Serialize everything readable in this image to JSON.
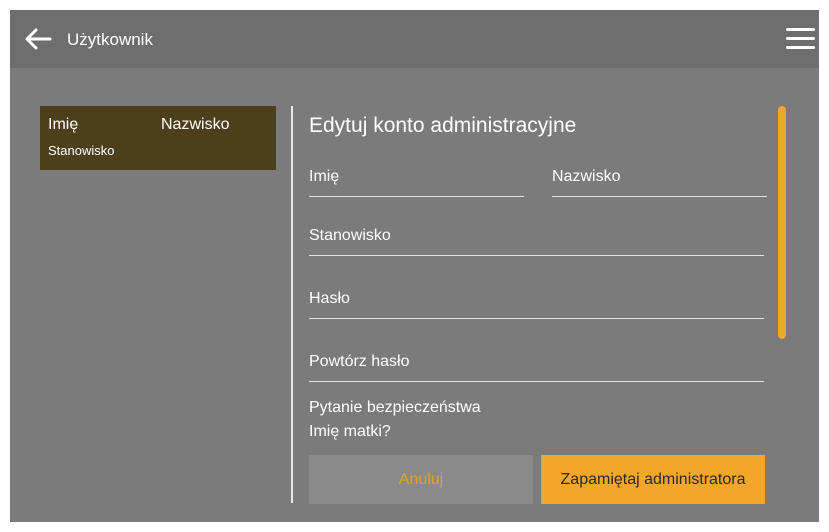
{
  "header": {
    "title": "Użytkownik",
    "back_icon": "arrow-left-icon",
    "menu_icon": "hamburger-menu-icon"
  },
  "user_card": {
    "first_name": "Imię",
    "last_name": "Nazwisko",
    "position": "Stanowisko"
  },
  "form": {
    "title": "Edytuj konto administracyjne",
    "first_name_placeholder": "Imię",
    "last_name_placeholder": "Nazwisko",
    "position_placeholder": "Stanowisko",
    "password_placeholder": "Hasło",
    "repeat_password_placeholder": "Powtórz hasło",
    "security_question_label": "Pytanie bezpieczeństwa",
    "security_question_value": "Imię matki?"
  },
  "buttons": {
    "cancel": "Anuluj",
    "save": "Zapamiętaj administratora"
  },
  "colors": {
    "accent": "#f2a62a",
    "card_bg": "#4e3f1c",
    "background": "#7b7b7b",
    "topbar": "#6e6e6e"
  }
}
